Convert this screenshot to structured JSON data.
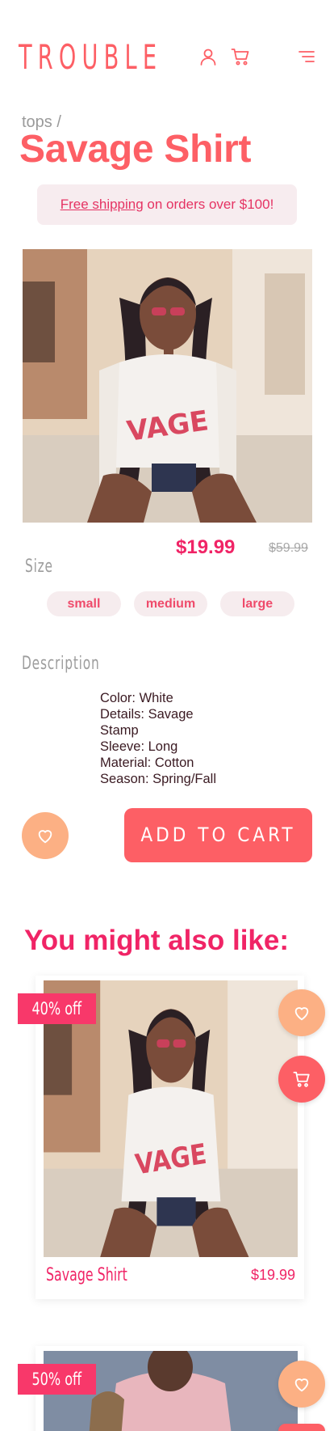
{
  "header": {
    "logo": "TROUBLE",
    "icons": [
      "user-icon",
      "cart-icon",
      "menu-icon"
    ]
  },
  "breadcrumb": "tops /",
  "product": {
    "title": "Savage Shirt",
    "price": "$19.99",
    "old_price": "$59.99"
  },
  "banner": {
    "link_text": "Free shipping",
    "rest_text": " on orders over $100!"
  },
  "size": {
    "label": "Size",
    "options": [
      "small",
      "medium",
      "large"
    ]
  },
  "description": {
    "label": "Description",
    "lines": [
      "Color: White",
      "Details: Savage",
      "Stamp",
      "Sleeve: Long",
      "Material: Cotton",
      "Season: Spring/Fall"
    ]
  },
  "actions": {
    "add_to_cart": "ADD TO CART"
  },
  "recommendations": {
    "heading": "You might also like:",
    "items": [
      {
        "badge": "40% off",
        "name": "Savage Shirt",
        "price": "$19.99"
      },
      {
        "badge": "50% off",
        "name": "",
        "price": ""
      }
    ]
  },
  "colors": {
    "brand": "#fd5f65",
    "accent": "#f02466",
    "peach": "#fcb084",
    "pill_bg": "#f6ecee"
  }
}
